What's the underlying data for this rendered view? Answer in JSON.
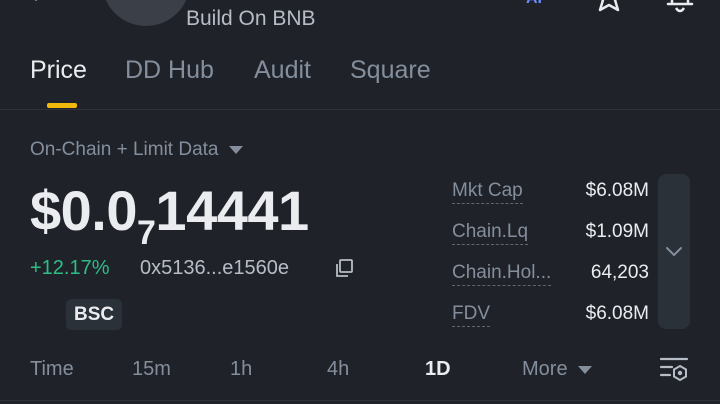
{
  "header": {
    "subtitle": "Build On BNB",
    "ai_label": "AI"
  },
  "tabs": [
    {
      "label": "Price",
      "active": true
    },
    {
      "label": "DD Hub",
      "active": false
    },
    {
      "label": "Audit",
      "active": false
    },
    {
      "label": "Square",
      "active": false
    }
  ],
  "source": {
    "label": "On-Chain + Limit Data"
  },
  "price": {
    "prefix": "$0.0",
    "zero_count": "7",
    "digits": "14441",
    "change": "+12.17%",
    "address": "0x5136...e1560e",
    "chain": "BSC"
  },
  "stats": [
    {
      "label": "Mkt Cap",
      "value": "$6.08M"
    },
    {
      "label": "Chain.Lq",
      "value": "$1.09M"
    },
    {
      "label": "Chain.Hol...",
      "value": "64,203"
    },
    {
      "label": "FDV",
      "value": "$6.08M"
    }
  ],
  "timeframes": [
    {
      "label": "Time",
      "active": false
    },
    {
      "label": "15m",
      "active": false
    },
    {
      "label": "1h",
      "active": false
    },
    {
      "label": "4h",
      "active": false
    },
    {
      "label": "1D",
      "active": true
    },
    {
      "label": "More",
      "active": false
    }
  ],
  "colors": {
    "background": "#1f2329",
    "accent": "#f0b90b",
    "positive": "#2ebd85",
    "ai": "#6b8cff"
  }
}
